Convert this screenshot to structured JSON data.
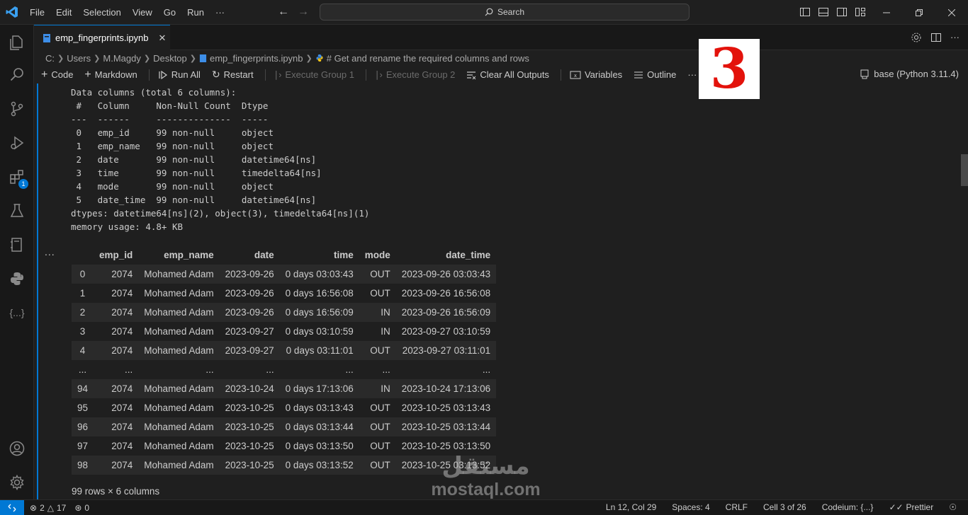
{
  "titlebar": {
    "menu": [
      "File",
      "Edit",
      "Selection",
      "View",
      "Go",
      "Run",
      "···"
    ],
    "search_label": "Search"
  },
  "activity_badge": "1",
  "tab": {
    "label": "emp_fingerprints.ipynb"
  },
  "breadcrumb": {
    "items": [
      "C:",
      "Users",
      "M.Magdy",
      "Desktop",
      "emp_fingerprints.ipynb",
      "# Get and rename the required columns and rows"
    ]
  },
  "toolbar": {
    "code": "Code",
    "markdown": "Markdown",
    "run_all": "Run All",
    "restart": "Restart",
    "execute_group_1": "Execute Group 1",
    "execute_group_2": "Execute Group 2",
    "clear_all_outputs": "Clear All Outputs",
    "variables": "Variables",
    "outline": "Outline",
    "more": "···",
    "kernel": "base (Python 3.11.4)"
  },
  "info_output": {
    "lines": [
      "Data columns (total 6 columns):",
      " #   Column     Non-Null Count  Dtype",
      "---  ------     --------------  -----",
      " 0   emp_id     99 non-null     object",
      " 1   emp_name   99 non-null     object",
      " 2   date       99 non-null     datetime64[ns]",
      " 3   time       99 non-null     timedelta64[ns]",
      " 4   mode       99 non-null     object",
      " 5   date_time  99 non-null     datetime64[ns]",
      "dtypes: datetime64[ns](2), object(3), timedelta64[ns](1)",
      "memory usage: 4.8+ KB"
    ]
  },
  "output_more": "...",
  "dataframe": {
    "columns": [
      "",
      "emp_id",
      "emp_name",
      "date",
      "time",
      "mode",
      "date_time"
    ],
    "rows": [
      [
        "0",
        "2074",
        "Mohamed Adam",
        "2023-09-26",
        "0 days 03:03:43",
        "OUT",
        "2023-09-26 03:03:43"
      ],
      [
        "1",
        "2074",
        "Mohamed Adam",
        "2023-09-26",
        "0 days 16:56:08",
        "OUT",
        "2023-09-26 16:56:08"
      ],
      [
        "2",
        "2074",
        "Mohamed Adam",
        "2023-09-26",
        "0 days 16:56:09",
        "IN",
        "2023-09-26 16:56:09"
      ],
      [
        "3",
        "2074",
        "Mohamed Adam",
        "2023-09-27",
        "0 days 03:10:59",
        "IN",
        "2023-09-27 03:10:59"
      ],
      [
        "4",
        "2074",
        "Mohamed Adam",
        "2023-09-27",
        "0 days 03:11:01",
        "OUT",
        "2023-09-27 03:11:01"
      ],
      [
        "...",
        "...",
        "...",
        "...",
        "...",
        "...",
        "..."
      ],
      [
        "94",
        "2074",
        "Mohamed Adam",
        "2023-10-24",
        "0 days 17:13:06",
        "IN",
        "2023-10-24 17:13:06"
      ],
      [
        "95",
        "2074",
        "Mohamed Adam",
        "2023-10-25",
        "0 days 03:13:43",
        "OUT",
        "2023-10-25 03:13:43"
      ],
      [
        "96",
        "2074",
        "Mohamed Adam",
        "2023-10-25",
        "0 days 03:13:44",
        "OUT",
        "2023-10-25 03:13:44"
      ],
      [
        "97",
        "2074",
        "Mohamed Adam",
        "2023-10-25",
        "0 days 03:13:50",
        "OUT",
        "2023-10-25 03:13:50"
      ],
      [
        "98",
        "2074",
        "Mohamed Adam",
        "2023-10-25",
        "0 days 03:13:52",
        "OUT",
        "2023-10-25 03:13:52"
      ]
    ],
    "shape": "99 rows × 6 columns"
  },
  "overlay_number": "3",
  "watermark": {
    "arabic": "مستقل",
    "latin": "mostaql.com"
  },
  "statusbar": {
    "errors": "2",
    "warnings": "17",
    "ports": "0",
    "position": "Ln 12, Col 29",
    "spaces": "Spaces: 4",
    "eol": "CRLF",
    "cell": "Cell 3 of 26",
    "codeium": "Codeium: {...}",
    "prettier": "Prettier"
  },
  "colors": {
    "accent": "#0078d4",
    "background": "#1f1f1f",
    "overlay_red": "#e3120b"
  }
}
